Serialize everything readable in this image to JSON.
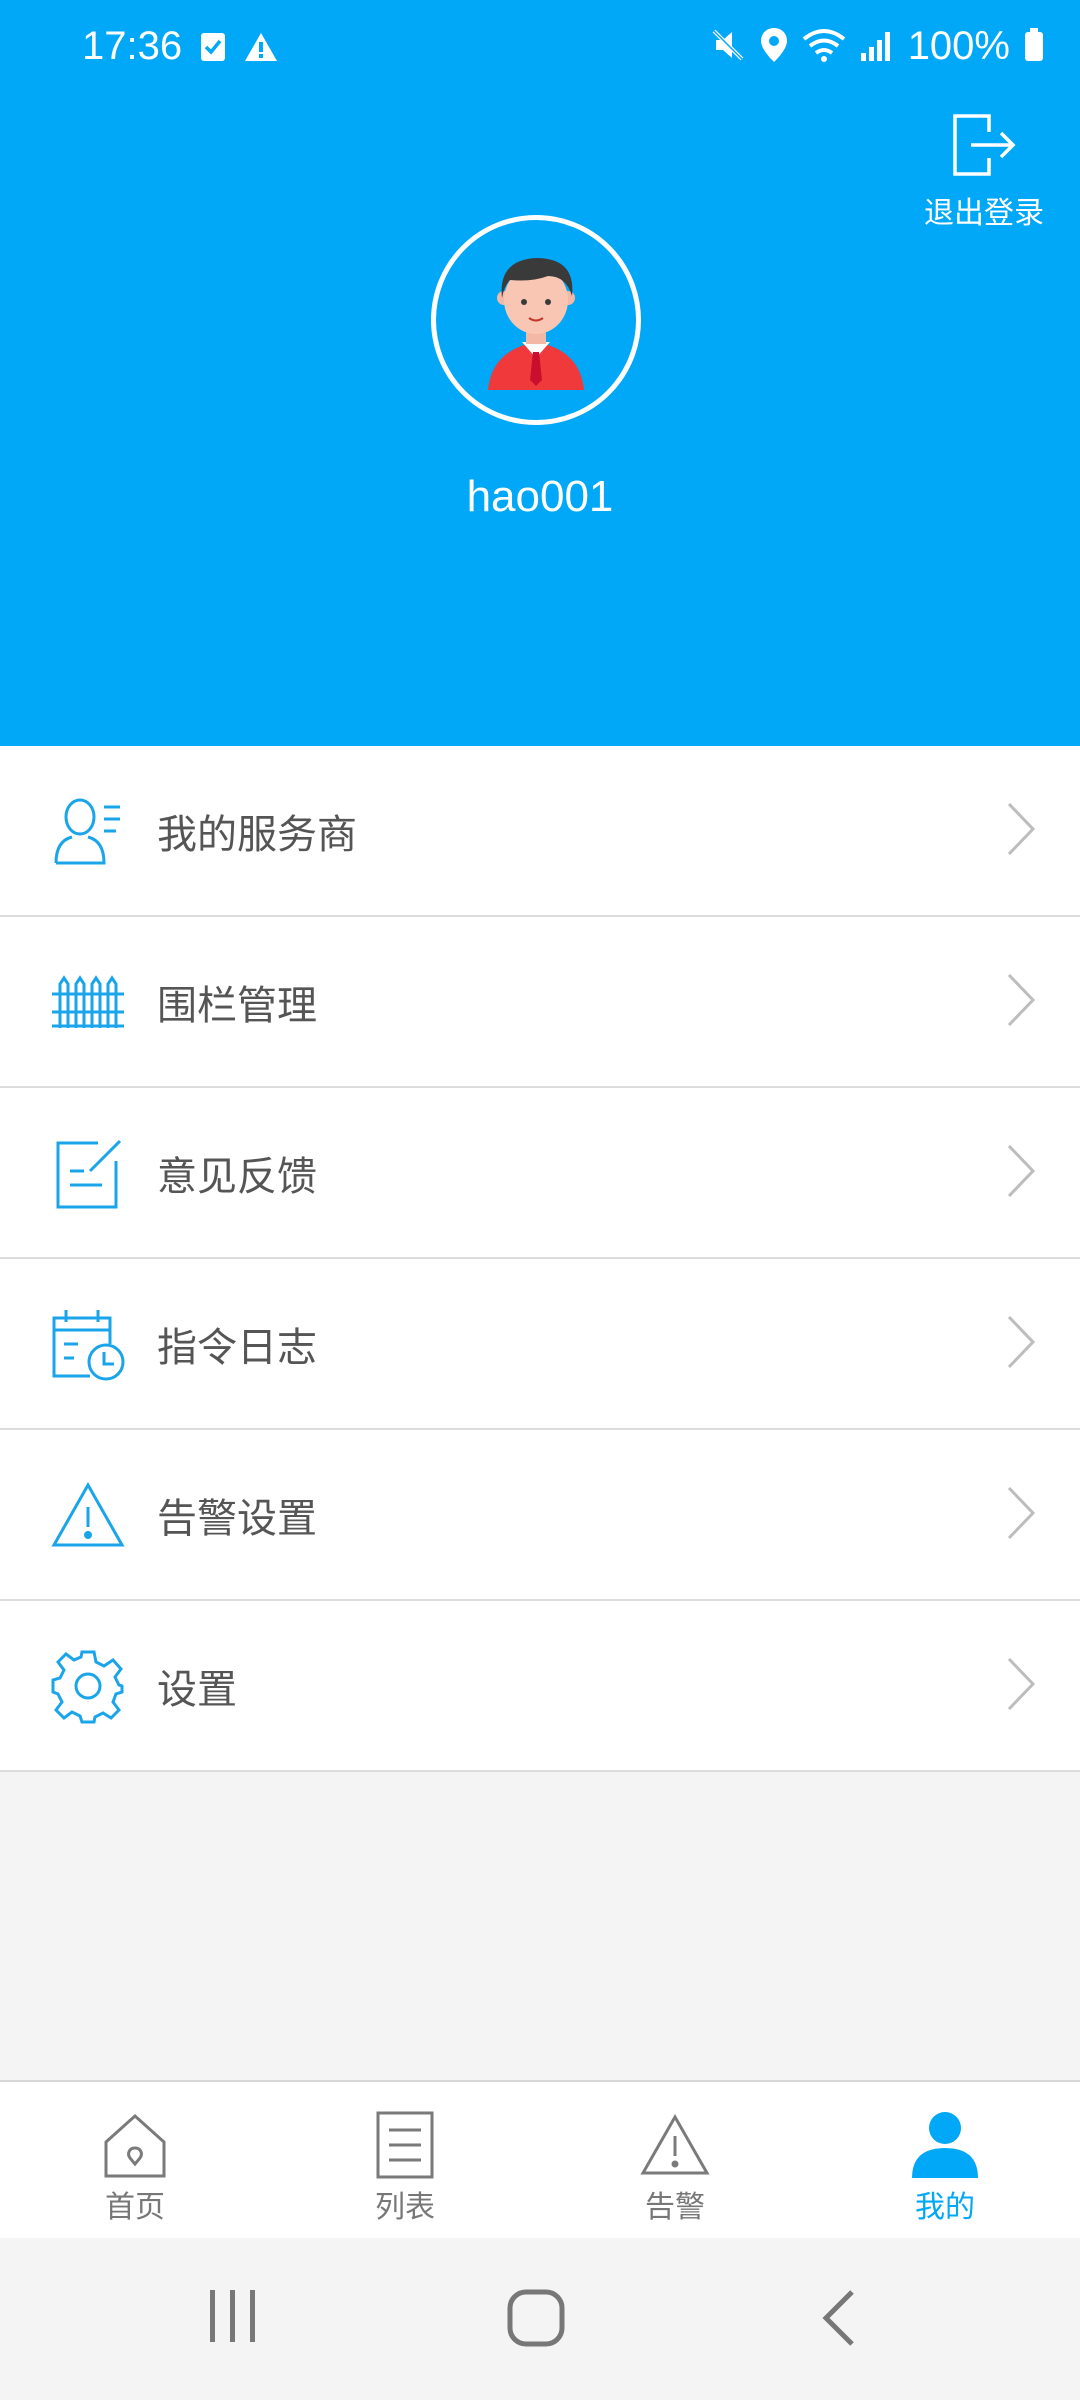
{
  "status_bar": {
    "time": "17:36",
    "battery": "100%",
    "icons": [
      "checkbox-icon",
      "warning-icon",
      "mute-icon",
      "location-icon",
      "wifi-icon",
      "signal-icon",
      "battery-icon"
    ]
  },
  "header": {
    "logout_label": "退出登录",
    "username": "hao001",
    "background_color": "#00a8f7"
  },
  "menu": {
    "items": [
      {
        "label": "我的服务商",
        "icon": "service-provider-icon"
      },
      {
        "label": "围栏管理",
        "icon": "fence-icon"
      },
      {
        "label": "意见反馈",
        "icon": "feedback-icon"
      },
      {
        "label": "指令日志",
        "icon": "command-log-icon"
      },
      {
        "label": "告警设置",
        "icon": "alarm-settings-icon"
      },
      {
        "label": "设置",
        "icon": "gear-icon"
      }
    ]
  },
  "bottom_nav": {
    "items": [
      {
        "label": "首页",
        "icon": "home-icon",
        "active": false
      },
      {
        "label": "列表",
        "icon": "list-icon",
        "active": false
      },
      {
        "label": "告警",
        "icon": "alert-icon",
        "active": false
      },
      {
        "label": "我的",
        "icon": "profile-icon",
        "active": true
      }
    ],
    "active_color": "#00a8f7"
  }
}
